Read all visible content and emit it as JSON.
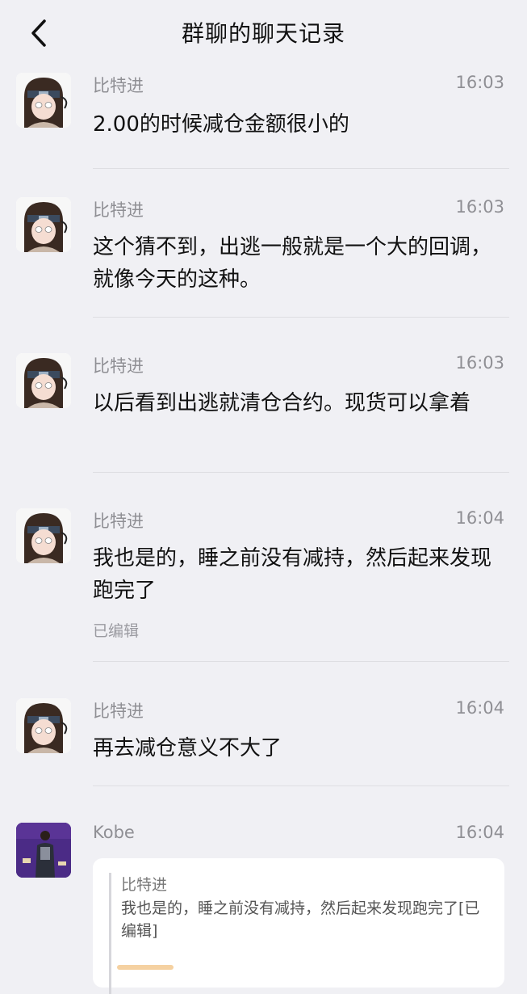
{
  "header": {
    "title": "群聊的聊天记录",
    "back_icon": "chevron-left-icon"
  },
  "messages": [
    {
      "sender": "比特进",
      "time": "16:03",
      "text": "2.00的时候减仓金额很小的"
    },
    {
      "sender": "比特进",
      "time": "16:03",
      "text": "这个猜不到，出逃一般就是一个大的回调，就像今天的这种。"
    },
    {
      "sender": "比特进",
      "time": "16:03",
      "text": "以后看到出逃就清仓合约。现货可以拿着"
    },
    {
      "sender": "比特进",
      "time": "16:04",
      "text": "我也是的，睡之前没有减持，然后起来发现跑完了",
      "edited": "已编辑"
    },
    {
      "sender": "比特进",
      "time": "16:04",
      "text": "再去减仓意义不大了"
    },
    {
      "sender": "Kobe",
      "time": "16:04",
      "quote": {
        "sender": "比特进",
        "text": "我也是的，睡之前没有减持，然后起来发现跑完了[已编辑]"
      }
    }
  ],
  "colors": {
    "background": "#f0f0f4",
    "meta_text": "#8f8f94",
    "divider": "#dedee2"
  }
}
